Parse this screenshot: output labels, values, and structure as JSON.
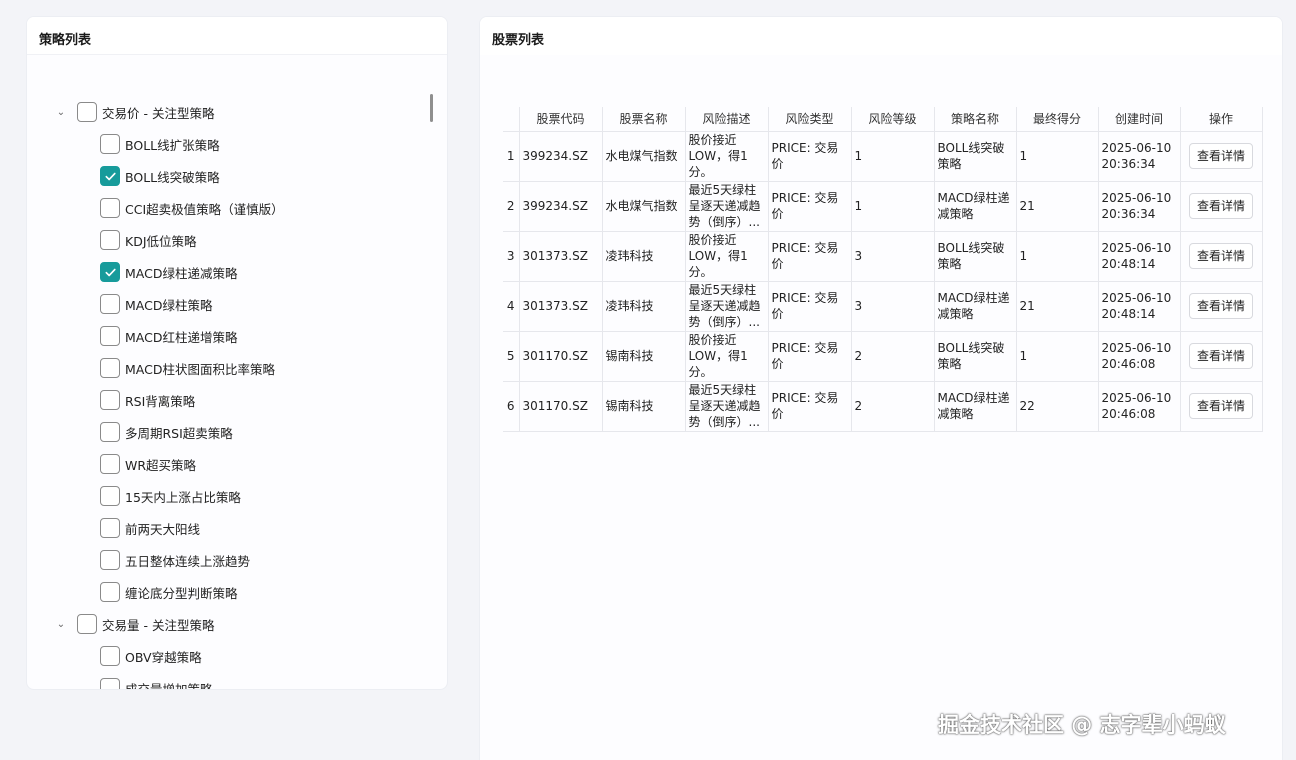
{
  "left_panel": {
    "title": "策略列表",
    "groups": [
      {
        "label": "交易价 - 关注型策略",
        "checked": false,
        "items": [
          {
            "label": "BOLL线扩张策略",
            "checked": false
          },
          {
            "label": "BOLL线突破策略",
            "checked": true
          },
          {
            "label": "CCI超卖极值策略（谨慎版）",
            "checked": false
          },
          {
            "label": "KDJ低位策略",
            "checked": false
          },
          {
            "label": "MACD绿柱递减策略",
            "checked": true
          },
          {
            "label": "MACD绿柱策略",
            "checked": false
          },
          {
            "label": "MACD红柱递增策略",
            "checked": false
          },
          {
            "label": "MACD柱状图面积比率策略",
            "checked": false
          },
          {
            "label": "RSI背离策略",
            "checked": false
          },
          {
            "label": "多周期RSI超卖策略",
            "checked": false
          },
          {
            "label": "WR超买策略",
            "checked": false
          },
          {
            "label": "15天内上涨占比策略",
            "checked": false
          },
          {
            "label": "前两天大阳线",
            "checked": false
          },
          {
            "label": "五日整体连续上涨趋势",
            "checked": false
          },
          {
            "label": "缠论底分型判断策略",
            "checked": false
          }
        ]
      },
      {
        "label": "交易量 - 关注型策略",
        "checked": false,
        "items": [
          {
            "label": "OBV穿越策略",
            "checked": false
          },
          {
            "label": "成交量增加策略",
            "checked": false
          }
        ]
      }
    ]
  },
  "right_panel": {
    "title": "股票列表",
    "columns": [
      "股票代码",
      "股票名称",
      "风险描述",
      "风险类型",
      "风险等级",
      "策略名称",
      "最终得分",
      "创建时间",
      "操作"
    ],
    "rows": [
      {
        "idx": "1",
        "code": "399234.SZ",
        "name": "水电煤气指数",
        "desc": [
          "股价接近",
          "LOW，得1",
          "分。"
        ],
        "type": "PRICE: 交易价",
        "level": "1",
        "strategy": [
          "BOLL线突破",
          "策略"
        ],
        "score": "1",
        "date": "2025-06-10",
        "time": "20:36:34",
        "action": "查看详情"
      },
      {
        "idx": "2",
        "code": "399234.SZ",
        "name": "水电煤气指数",
        "desc": [
          "最近5天绿柱",
          "呈逐天递减趋",
          "势（倒序）..."
        ],
        "type": "PRICE: 交易价",
        "level": "1",
        "strategy": [
          "MACD绿柱递",
          "减策略"
        ],
        "score": "21",
        "date": "2025-06-10",
        "time": "20:36:34",
        "action": "查看详情"
      },
      {
        "idx": "3",
        "code": "301373.SZ",
        "name": "凌玮科技",
        "desc": [
          "股价接近",
          "LOW，得1",
          "分。"
        ],
        "type": "PRICE: 交易价",
        "level": "3",
        "strategy": [
          "BOLL线突破",
          "策略"
        ],
        "score": "1",
        "date": "2025-06-10",
        "time": "20:48:14",
        "action": "查看详情"
      },
      {
        "idx": "4",
        "code": "301373.SZ",
        "name": "凌玮科技",
        "desc": [
          "最近5天绿柱",
          "呈逐天递减趋",
          "势（倒序）..."
        ],
        "type": "PRICE: 交易价",
        "level": "3",
        "strategy": [
          "MACD绿柱递",
          "减策略"
        ],
        "score": "21",
        "date": "2025-06-10",
        "time": "20:48:14",
        "action": "查看详情"
      },
      {
        "idx": "5",
        "code": "301170.SZ",
        "name": "锡南科技",
        "desc": [
          "股价接近",
          "LOW，得1",
          "分。"
        ],
        "type": "PRICE: 交易价",
        "level": "2",
        "strategy": [
          "BOLL线突破",
          "策略"
        ],
        "score": "1",
        "date": "2025-06-10",
        "time": "20:46:08",
        "action": "查看详情"
      },
      {
        "idx": "6",
        "code": "301170.SZ",
        "name": "锡南科技",
        "desc": [
          "最近5天绿柱",
          "呈逐天递减趋",
          "势（倒序）..."
        ],
        "type": "PRICE: 交易价",
        "level": "2",
        "strategy": [
          "MACD绿柱递",
          "减策略"
        ],
        "score": "22",
        "date": "2025-06-10",
        "time": "20:46:08",
        "action": "查看详情"
      }
    ]
  },
  "watermark": "掘金技术社区 @ 志字辈小蚂蚁",
  "colors": {
    "checkbox_checked": "#179b9b",
    "background": "#f3f4f8"
  }
}
